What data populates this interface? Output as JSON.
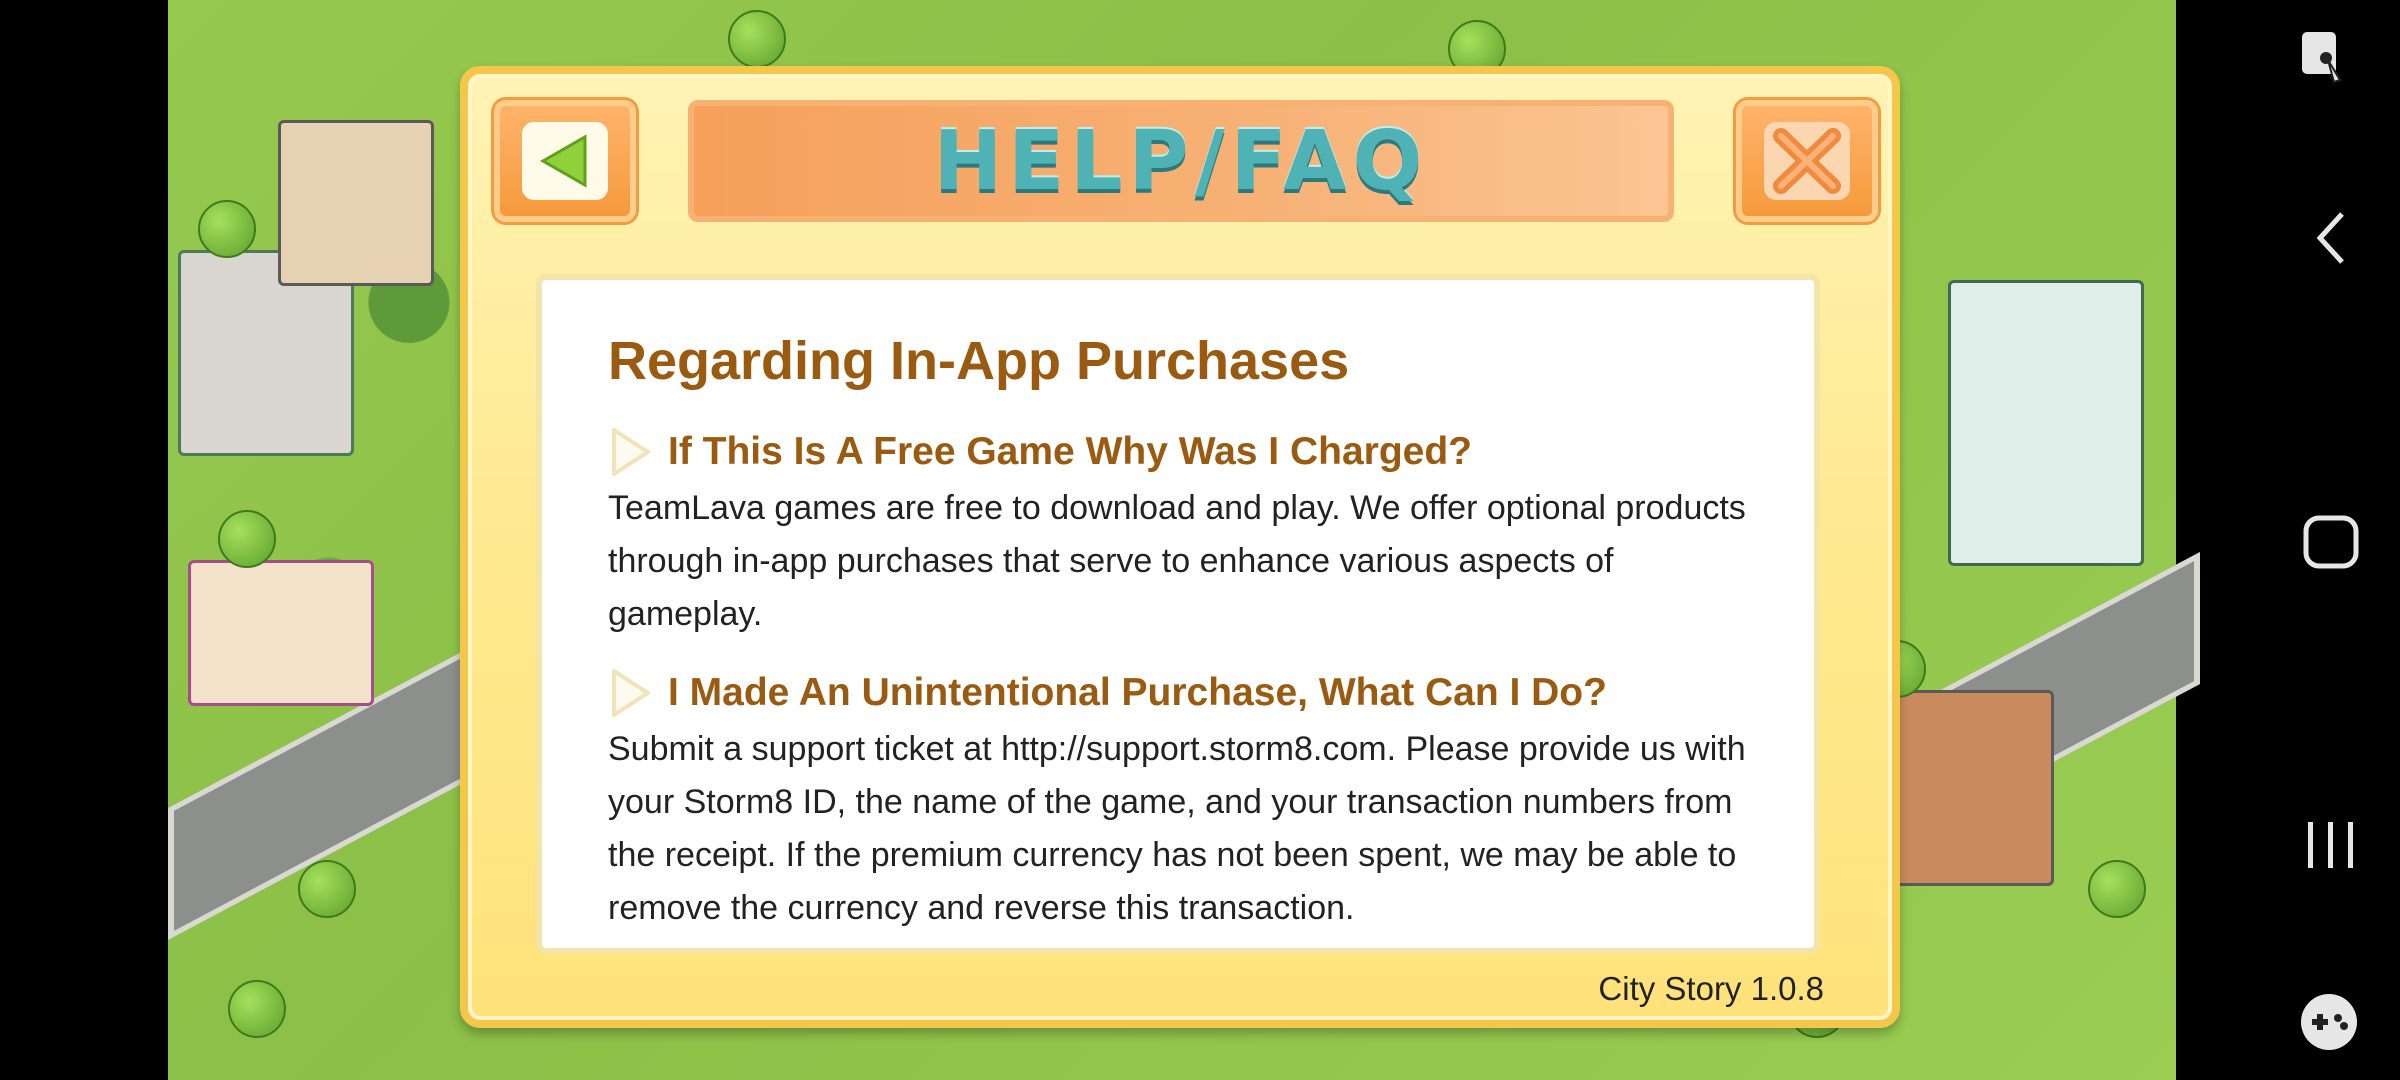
{
  "dialog": {
    "title": "HELP/FAQ",
    "section_heading": "Regarding In-App Purchases",
    "faq": [
      {
        "question": "If This Is A Free Game Why Was I Charged?",
        "answer": "TeamLava games are free to download and play. We offer optional products through in-app purchases that serve to enhance various aspects of gameplay."
      },
      {
        "question": "I Made An Unintentional Purchase, What Can I Do?",
        "answer": "Submit a support ticket at http://support.storm8.com. Please provide us with your Storm8 ID, the name of the game, and your transaction numbers from the receipt. If the premium currency has not been spent, we may be able to remove the currency and reverse this transaction."
      }
    ],
    "version": "City Story 1.0.8"
  },
  "icons": {
    "back": "back-arrow-icon",
    "close": "close-x-icon",
    "bullet": "bullet-arrow-icon"
  },
  "colors": {
    "title_text": "#4fb3b6",
    "heading_text": "#9a5a10",
    "dialog_bg": "#ffe98f",
    "button_orange": "#f59a3b"
  }
}
